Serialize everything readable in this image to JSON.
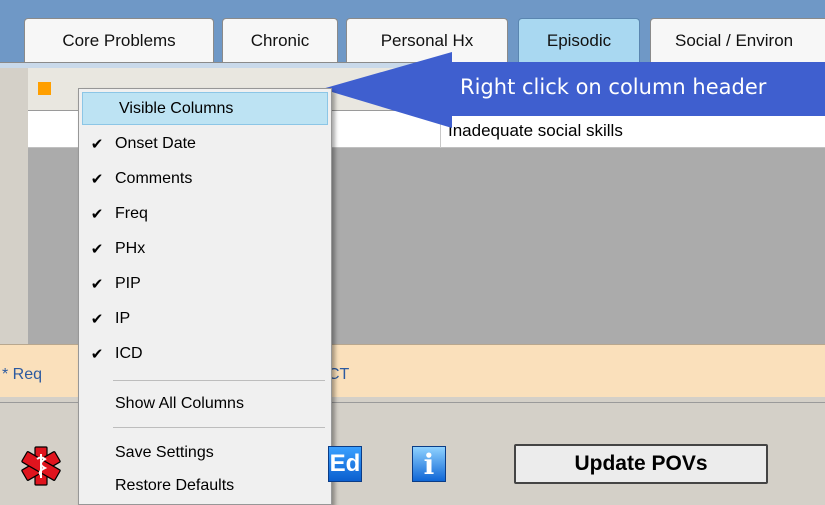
{
  "tabs": [
    {
      "label": "Core Problems"
    },
    {
      "label": "Chronic"
    },
    {
      "label": "Personal Hx"
    },
    {
      "label": "Episodic",
      "active": true
    },
    {
      "label": "Social / Environ"
    }
  ],
  "grid": {
    "row_text": "Inadequate social skills",
    "accent": "#ff9f00"
  },
  "callout": {
    "text": "Right click on column header",
    "color": "#3f5fcf"
  },
  "context_menu": {
    "title_item": "Visible Columns",
    "check_items": [
      {
        "label": "Onset Date",
        "checked": true
      },
      {
        "label": "Comments",
        "checked": true
      },
      {
        "label": "Freq",
        "checked": true
      },
      {
        "label": "PHx",
        "checked": true
      },
      {
        "label": "PIP",
        "checked": true
      },
      {
        "label": "IP",
        "checked": true
      },
      {
        "label": "ICD",
        "checked": true
      }
    ],
    "show_all": "Show All Columns",
    "save": "Save Settings",
    "restore": "Restore Defaults"
  },
  "status": {
    "required_text": "* Req",
    "ct_text": "CT"
  },
  "toolbar": {
    "ed_icon_text": "Ed",
    "info_icon_text": "i",
    "update_label": "Update POVs"
  }
}
